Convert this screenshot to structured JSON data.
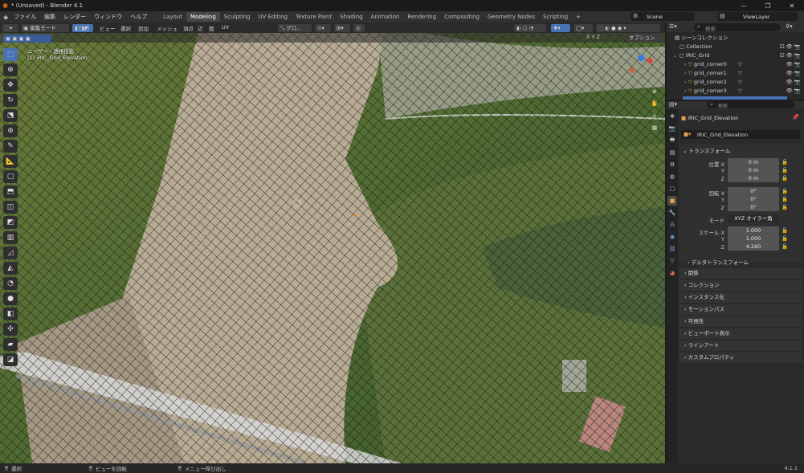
{
  "window": {
    "title": "* (Unsaved) - Blender 4.1",
    "controls": [
      "—",
      "❐",
      "✕"
    ]
  },
  "menu": [
    "ファイル",
    "編集",
    "レンダー",
    "ウィンドウ",
    "ヘルプ"
  ],
  "workspaces": [
    "Layout",
    "Modeling",
    "Sculpting",
    "UV Editing",
    "Texture Paint",
    "Shading",
    "Animation",
    "Rendering",
    "Compositing",
    "Geometry Nodes",
    "Scripting"
  ],
  "active_workspace": "Modeling",
  "scene_label": "Scene",
  "view_layer_label": "ViewLayer",
  "viewport": {
    "mode": "編集モード",
    "header_menus": [
      "ビュー",
      "選択",
      "追加",
      "メッシュ",
      "頂点",
      "辺",
      "面",
      "UV"
    ],
    "transform_orientation": "グロ...",
    "overlay_label": "オプション",
    "view_name": "ユーザー・透視投影",
    "object_name": "(1) iRIC_Grid_Elevation",
    "axes": [
      "X",
      "Y",
      "Z"
    ]
  },
  "outliner": {
    "search_placeholder": "検索",
    "scene_collection": "シーンコレクション",
    "items": [
      {
        "label": "Collection",
        "indent": 1
      },
      {
        "label": "iRIC_Grid",
        "indent": 1
      },
      {
        "label": "grid_corner0",
        "indent": 2
      },
      {
        "label": "grid_corner1",
        "indent": 2
      },
      {
        "label": "grid_corner2",
        "indent": 2
      },
      {
        "label": "grid_corner3",
        "indent": 2
      }
    ]
  },
  "properties": {
    "search_placeholder": "検索",
    "object_header": "iRIC_Grid_Elevation",
    "object_name_field": "iRIC_Grid_Elevation",
    "transform_section": "トランスフォーム",
    "location_label": "位置 X",
    "location": [
      "0 m",
      "0 m",
      "0 m"
    ],
    "rotation_label": "回転 X",
    "rotation": [
      "0°",
      "0°",
      "0°"
    ],
    "mode_label": "モード",
    "mode_value": "XYZ オイラー角",
    "scale_label": "スケール X",
    "scale": [
      "1.000",
      "1.000",
      "4.260"
    ],
    "axis_y": "Y",
    "axis_z": "Z",
    "delta_transform": "デルタトランスフォーム",
    "sections": [
      "関係",
      "コレクション",
      "インスタンス化",
      "モーションパス",
      "可視性",
      "ビューポート表示",
      "ラインアート",
      "カスタムプロパティ"
    ]
  },
  "statusbar": {
    "select": "選択",
    "rotate": "ビューを回転",
    "menu": "メニュー呼び出し",
    "version": "4.1.1"
  }
}
